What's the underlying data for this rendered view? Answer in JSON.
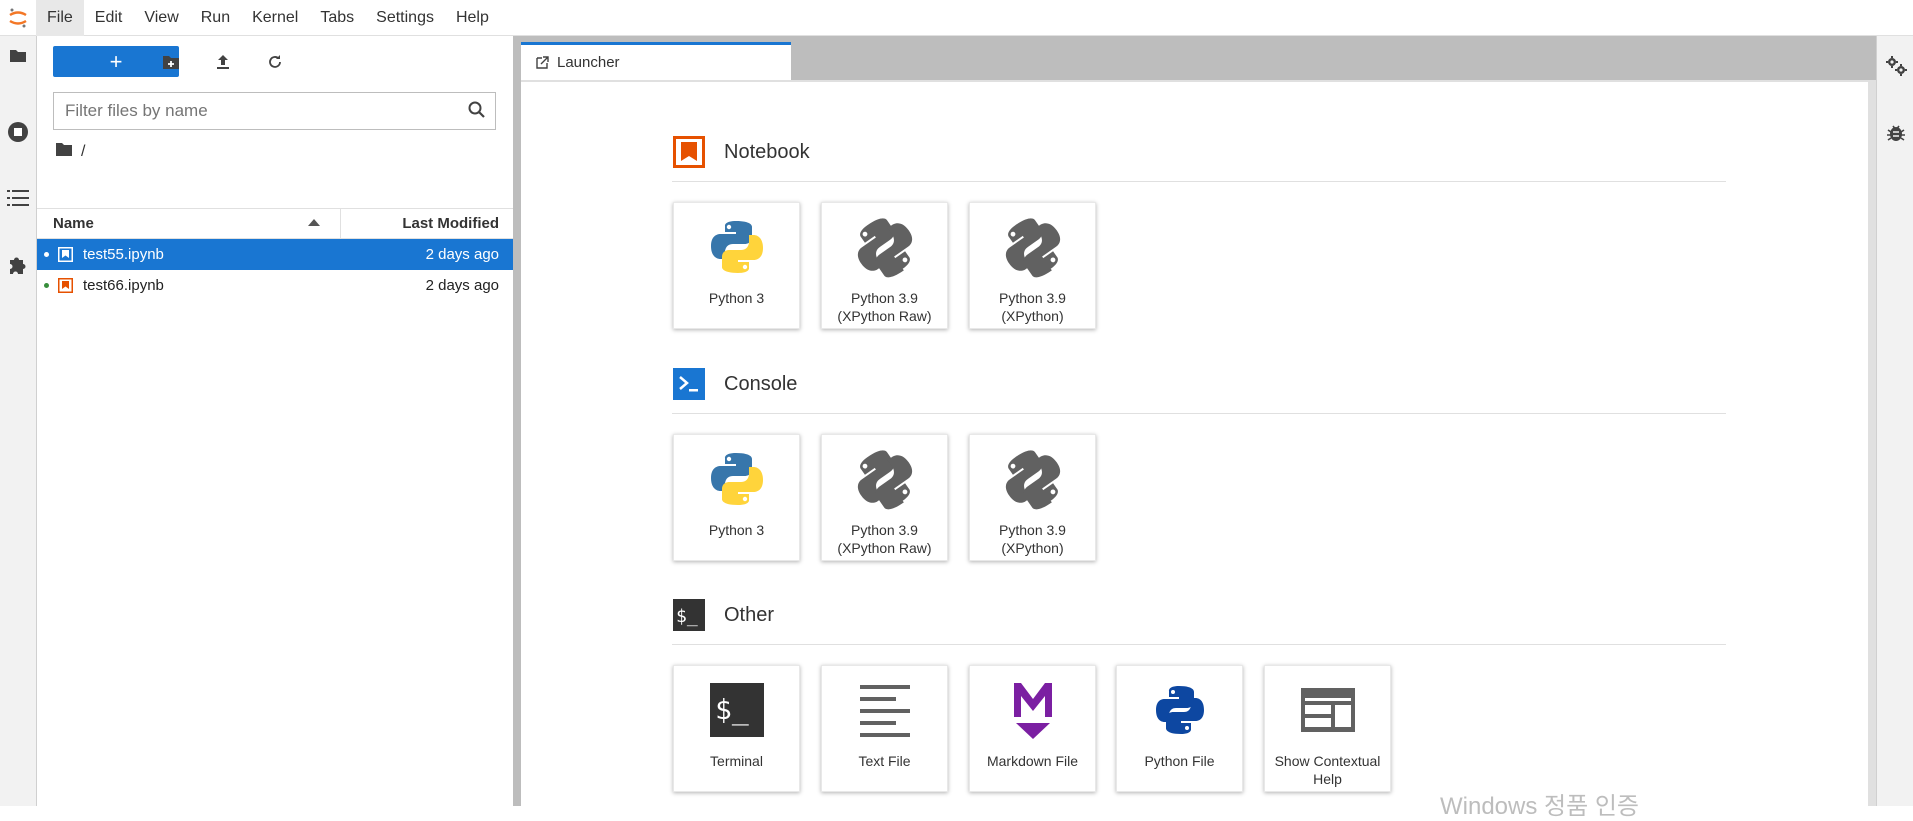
{
  "menubar": {
    "items": [
      "File",
      "Edit",
      "View",
      "Run",
      "Kernel",
      "Tabs",
      "Settings",
      "Help"
    ]
  },
  "file_browser": {
    "new_label": "+",
    "search": {
      "placeholder": "Filter files by name",
      "value": ""
    },
    "breadcrumb": "/",
    "columns": {
      "name": "Name",
      "modified": "Last Modified"
    },
    "files": [
      {
        "name": "test55.ipynb",
        "modified": "2 days ago",
        "selected": true
      },
      {
        "name": "test66.ipynb",
        "modified": "2 days ago",
        "selected": false
      }
    ]
  },
  "tab": {
    "label": "Launcher"
  },
  "launcher": {
    "notebook": {
      "title": "Notebook",
      "cards": [
        {
          "label": "Python 3",
          "icon": "python-icon"
        },
        {
          "label": "Python 3.9\n(XPython Raw)",
          "icon": "xpython-icon"
        },
        {
          "label": "Python 3.9\n(XPython)",
          "icon": "xpython-icon"
        }
      ]
    },
    "console": {
      "title": "Console",
      "cards": [
        {
          "label": "Python 3",
          "icon": "python-icon"
        },
        {
          "label": "Python 3.9\n(XPython Raw)",
          "icon": "xpython-icon"
        },
        {
          "label": "Python 3.9\n(XPython)",
          "icon": "xpython-icon"
        }
      ]
    },
    "other": {
      "title": "Other",
      "cards": [
        {
          "label": "Terminal",
          "icon": "terminal-icon"
        },
        {
          "label": "Text File",
          "icon": "text-file-icon"
        },
        {
          "label": "Markdown File",
          "icon": "markdown-icon"
        },
        {
          "label": "Python File",
          "icon": "python-file-icon"
        },
        {
          "label": "Show Contextual\nHelp",
          "icon": "contextual-help-icon"
        }
      ]
    }
  },
  "watermark": "Windows 정품 인증",
  "colors": {
    "accent": "#1976d2",
    "notebook_orange": "#e65100",
    "markdown_purple": "#7b1fa2",
    "icon_gray": "#616161"
  }
}
